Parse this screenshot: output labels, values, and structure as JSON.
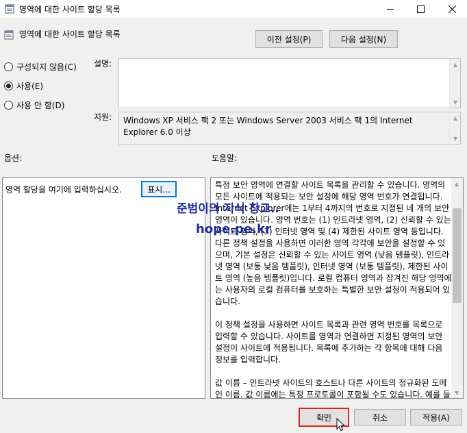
{
  "window": {
    "title": "영역에 대한 사이트 할당 목록",
    "icon": "policy-doc-icon",
    "controls": [
      "minimize-icon",
      "maximize-icon",
      "close-icon"
    ]
  },
  "header": {
    "title": "영역에 대한 사이트 할당 목록",
    "prev_label": "이전 설정(P)",
    "next_label": "다음 설정(N)"
  },
  "state": {
    "options": [
      {
        "label": "구성되지 않음(C)",
        "selected": false
      },
      {
        "label": "사용(E)",
        "selected": true
      },
      {
        "label": "사용 안 함(D)",
        "selected": false
      }
    ]
  },
  "comment": {
    "label": "설명:",
    "value": ""
  },
  "supported": {
    "label": "지원:",
    "value": "Windows XP 서비스 팩 2 또는 Windows Server 2003 서비스 팩 1의 Internet Explorer 6.0 이상"
  },
  "options_section": {
    "label": "옵션:",
    "field_label": "영역 할당을 여기에 입력하십시오.",
    "show_button": "표시..."
  },
  "help_section": {
    "label": "도움말:",
    "paragraphs": [
      "특정 보안 영역에 연결할 사이트 목록을 관리할 수 있습니다. 영역의 모든 사이트에 적용되는 보안 설정에 해당 영역 번호가 연결됩니다. Internet Explorer에는 1부터 4까지의 번호로 지정된 네 개의 보안 영역이 있습니다. 영역 번호는 (1) 인트라넷 영역, (2) 신뢰할 수 있는 사이트 영역, (3) 인터넷 영역 및 (4) 제한된 사이트 영역 등입니다. 다른 정책 설정을 사용하면 이러한 영역 각각에 보안을 설정할 수 있으며, 기본 설정은 신뢰할 수 있는 사이트 영역 (낮음 템플릿), 인트라넷 영역 (보통 낮음 템플릿), 인터넷 영역 (보통 템플릿), 제한된 사이트 영역 (높음 템플릿)입니다. 로컬 컴퓨터 영역과 잠겨진 해당 영역에는 사용자의 로컬 컴퓨터를 보호하는 특별한 보안 설정이 적용되어 있습니다.",
      "이 정책 설정을 사용하면 사이트 목록과 관련 영역 번호를 목록으로 입력할 수 있습니다. 사이트를 영역과 연결하면 지정된 영역의 보안 설정이 사이트에 적용됩니다.  목록에 추가하는 각 항목에 대해 다음 정보를 입력합니다.",
      "값 이름 – 인트라넷 사이트의 호스트나 다른 사이트의 정규화된 도메인 이름. 값 이름에는 특정 프로토콜이 포함될 수도 있습니다. 예를 들어 값 이름으로 http://www.contoso.com을 입력하면"
    ]
  },
  "watermark": {
    "line1": "준범이의 지식 창고..",
    "line2": "hope.pe.kr"
  },
  "footer": {
    "ok_label": "확인",
    "cancel_label": "취소",
    "apply_label": "적용(A)"
  }
}
